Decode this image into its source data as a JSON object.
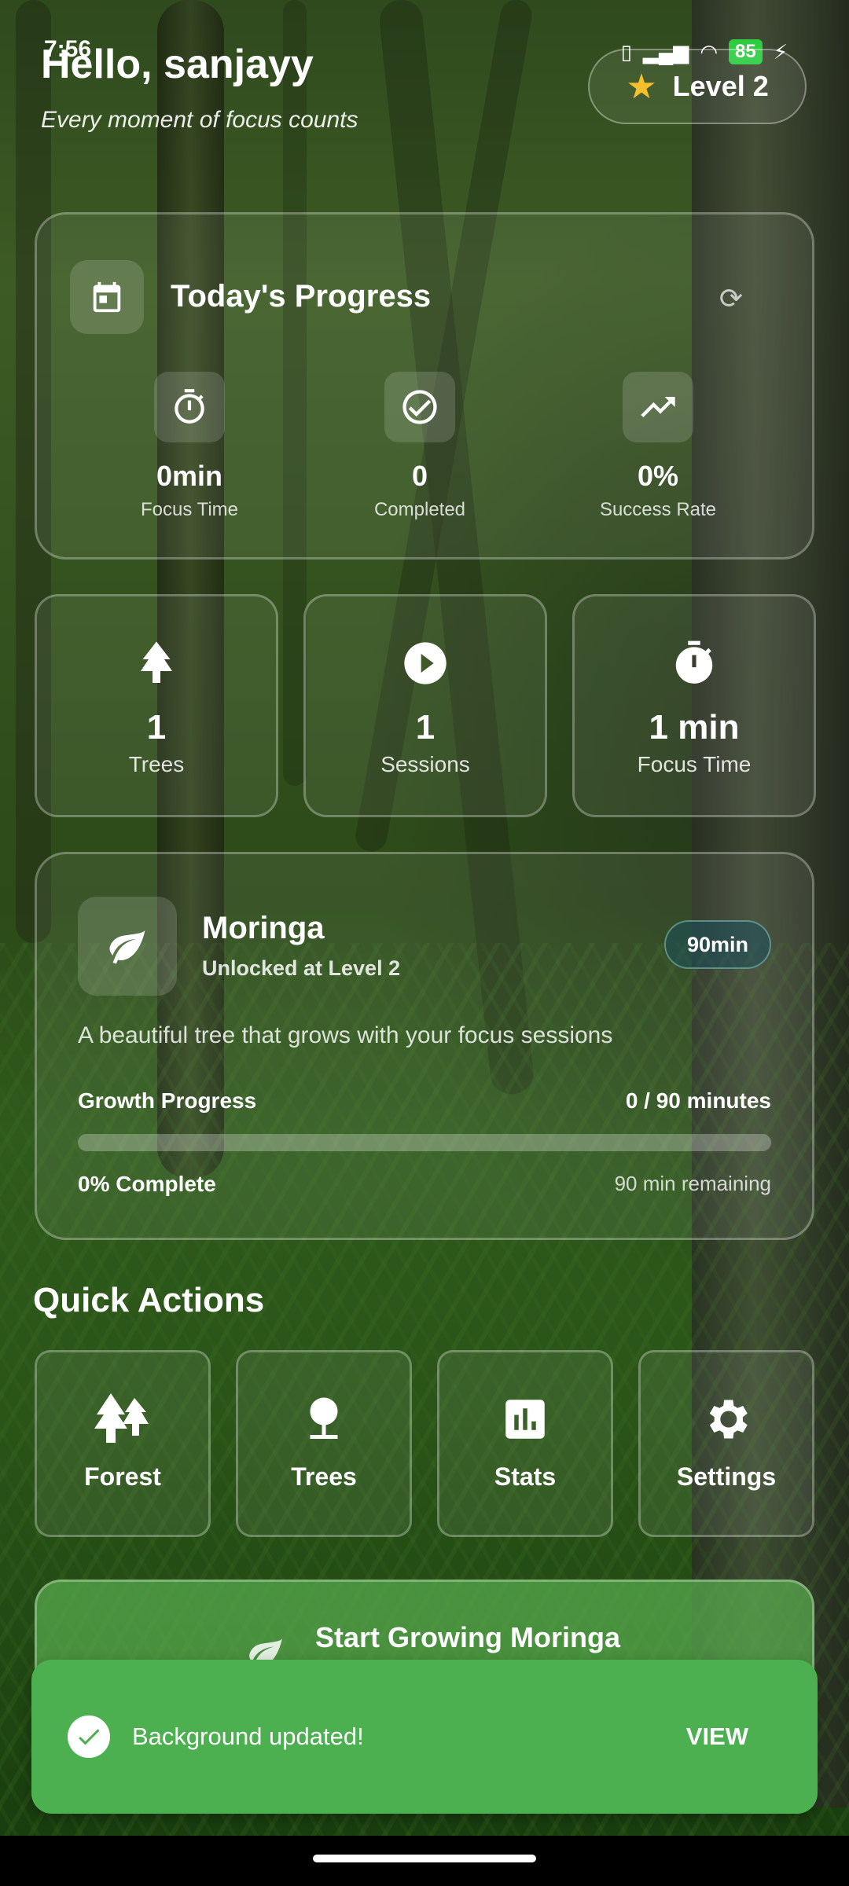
{
  "status_bar": {
    "time": "7:56",
    "battery": "85"
  },
  "header": {
    "greeting": "Hello, sanjayy",
    "tagline": "Every moment of focus counts",
    "level": "Level 2"
  },
  "today": {
    "title": "Today's Progress",
    "stats": [
      {
        "value": "0min",
        "label": "Focus Time",
        "icon": "timer-icon"
      },
      {
        "value": "0",
        "label": "Completed",
        "icon": "check-circle-icon"
      },
      {
        "value": "0%",
        "label": "Success Rate",
        "icon": "trending-up-icon"
      }
    ]
  },
  "totals": [
    {
      "value": "1",
      "label": "Trees",
      "icon": "tree-icon"
    },
    {
      "value": "1",
      "label": "Sessions",
      "icon": "play-circle-icon"
    },
    {
      "value": "1 min",
      "label": "Focus Time",
      "icon": "stopwatch-icon"
    }
  ],
  "tree": {
    "name": "Moringa",
    "unlock": "Unlocked at Level 2",
    "duration": "90min",
    "description": "A beautiful tree that grows with your focus sessions",
    "progress_label": "Growth Progress",
    "progress_value": "0 / 90 minutes",
    "progress_fraction": 0,
    "percent_text": "0% Complete",
    "remaining": "90 min remaining"
  },
  "quick_actions": {
    "title": "Quick Actions",
    "items": [
      {
        "label": "Forest",
        "icon": "forest-icon"
      },
      {
        "label": "Trees",
        "icon": "tree-icon"
      },
      {
        "label": "Stats",
        "icon": "bar-chart-icon"
      },
      {
        "label": "Settings",
        "icon": "gear-icon"
      }
    ]
  },
  "start_button": {
    "label": "Start Growing Moringa"
  },
  "snackbar": {
    "message": "Background updated!",
    "action": "VIEW"
  },
  "colors": {
    "accent_green": "#4caf50",
    "star": "#f6c02c",
    "progress_fill": "#8fd36a"
  }
}
